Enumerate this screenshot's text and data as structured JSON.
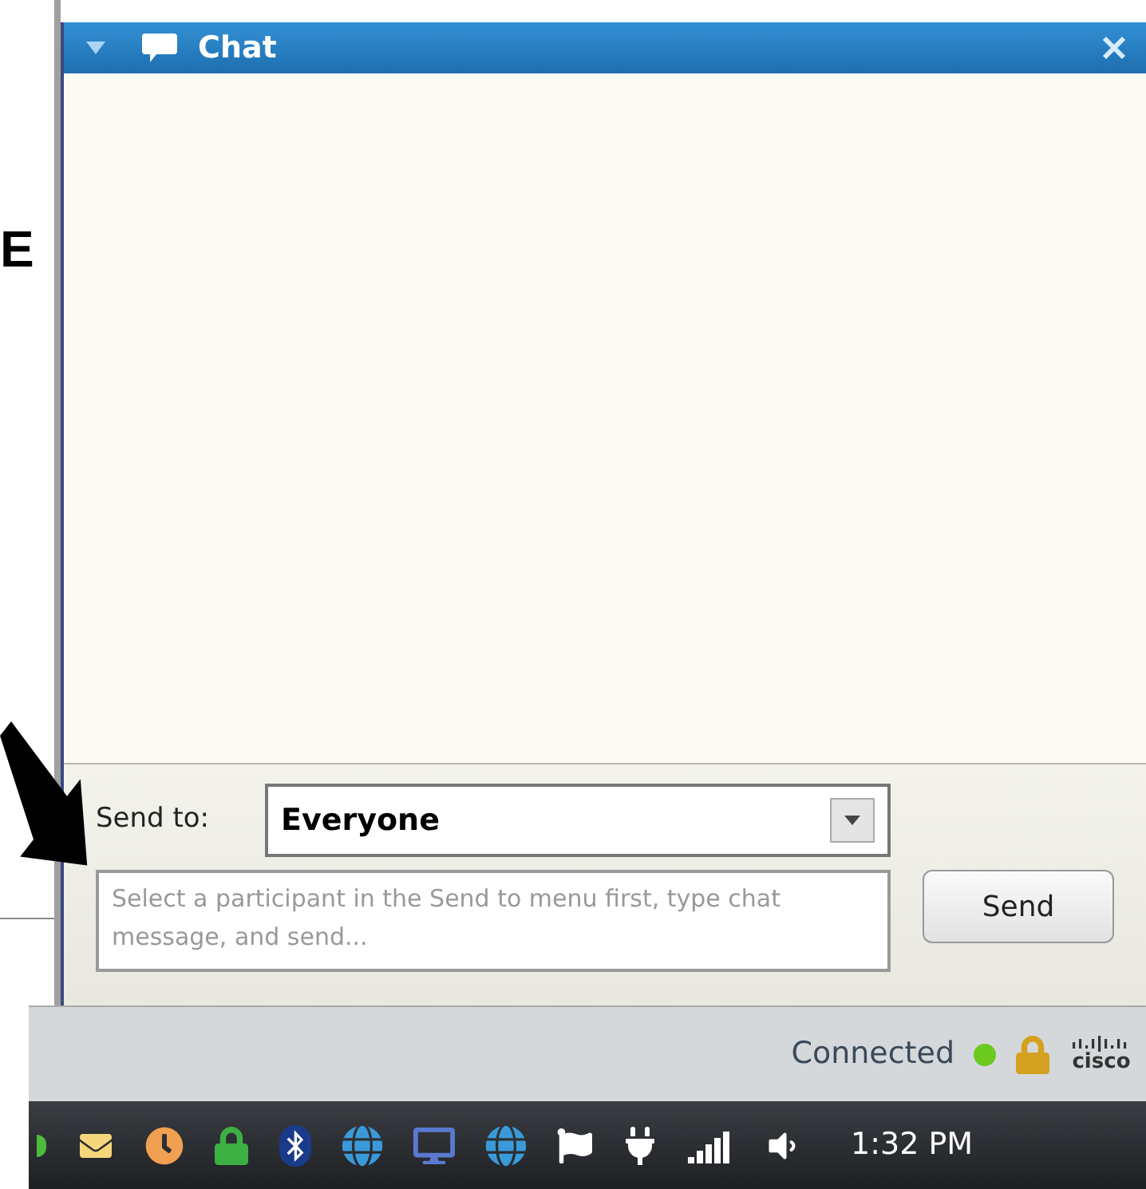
{
  "background_text": "E",
  "chat_panel": {
    "title": "Chat",
    "expanded": true
  },
  "send_to": {
    "label": "Send to:",
    "value": "Everyone"
  },
  "message_field": {
    "placeholder": "Select a participant in the Send to menu first, type chat message, and send..."
  },
  "send_button": "Send",
  "status_bar": {
    "status": "Connected",
    "indicator_on": true,
    "logo_text": "cisco"
  },
  "taskbar": {
    "clock": "1:32 PM"
  }
}
